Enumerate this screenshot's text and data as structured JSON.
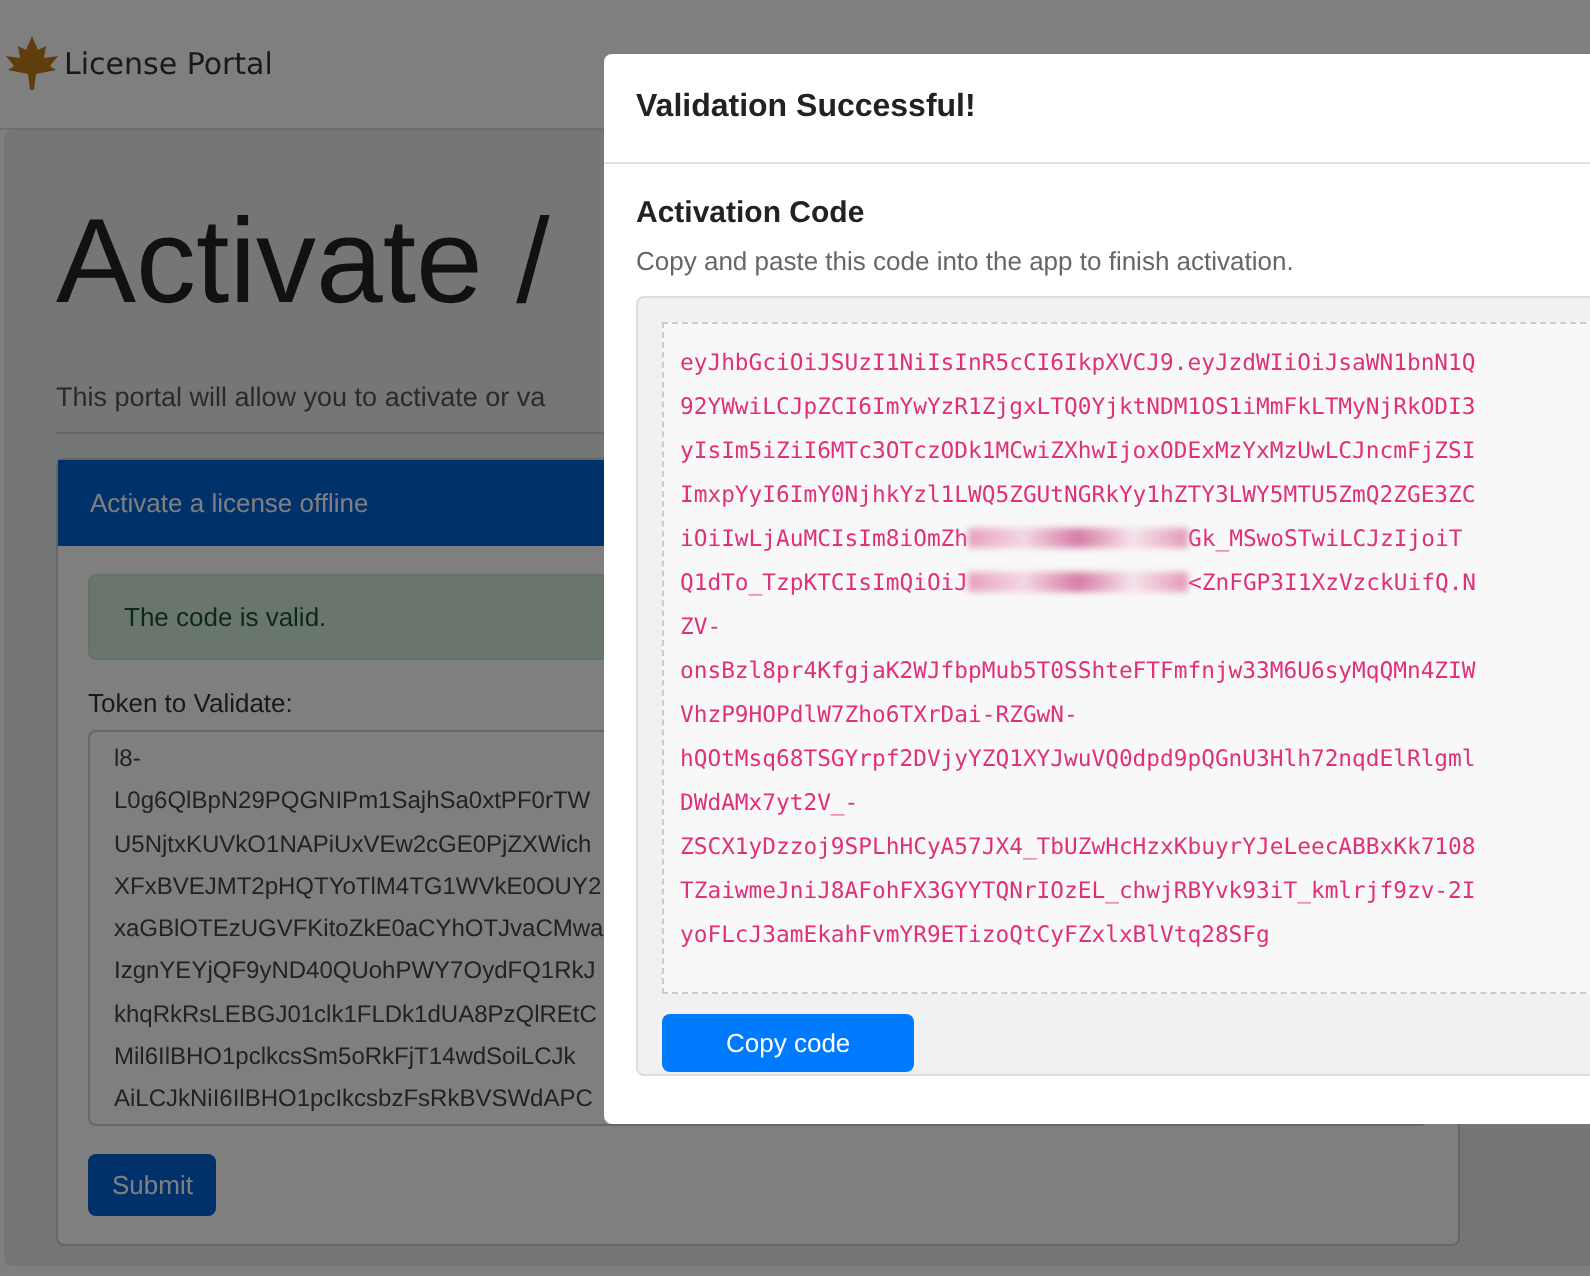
{
  "navbar": {
    "brand": "License Portal"
  },
  "page": {
    "title": "Activate /",
    "subtitle": "This portal will allow you to activate or va",
    "card": {
      "header": "Activate a license offline",
      "alert": "The code is valid.",
      "label": "Token to Validate:",
      "token_lines": [
        "l8-",
        "L0g6QlBpN29PQGNIPm1SajhSa0xtPF0rTW",
        "U5NjtxKUVkO1NAPiUxVEw2cGE0PjZXWich",
        "XFxBVEJMT2pHQTYoTlM4TG1WVkE0OUY2",
        "xaGBlOTEzUGVFKitoZkE0aCYhOTJvaCMwa",
        "IzgnYEYjQF9yND40QUohPWY7OydFQ1RkJ",
        "khqRkRsLEBGJ01clk1FLDk1dUA8PzQlREtC",
        "Mil6IlBHO1pclkcsSm5oRkFjT14wdSoiLCJk",
        "AiLCJkNiI6IlBHO1pcIkcsbzFsRkBVSWdAPC"
      ],
      "submit": "Submit"
    }
  },
  "modal": {
    "title": "Validation Successful!",
    "heading": "Activation Code",
    "hint": "Copy and paste this code into the app to finish activation.",
    "code_lines": [
      {
        "kind": "plain",
        "text": "eyJhbGciOiJSUzI1NiIsInR5cCI6IkpXVCJ9.eyJzdWIiOiJsaWN1bnN1Q"
      },
      {
        "kind": "plain",
        "text": "92YWwiLCJpZCI6ImYwYzR1ZjgxLTQ0YjktNDM1OS1iMmFkLTMyNjRkODI3"
      },
      {
        "kind": "plain",
        "text": "yIsIm5iZiI6MTc3OTczODk1MCwiZXhwIjoxODExMzYxMzUwLCJncmFjZSI"
      },
      {
        "kind": "plain",
        "text": "ImxpYyI6ImY0NjhkYzl1LWQ5ZGUtNGRkYy1hZTY3LWY5MTU5ZmQ2ZGE3ZC"
      },
      {
        "kind": "redacted",
        "before": "iOiIwLjAuMCIsIm8iOmZh",
        "after": "Gk_MSwoSTwiLCJzIjoiT"
      },
      {
        "kind": "redacted",
        "before": "Q1dTo_TzpKTCIsImQiOiJ",
        "after": "<ZnFGP3I1XzVzckUifQ.N"
      },
      {
        "kind": "plain",
        "text": "ZV-"
      },
      {
        "kind": "plain",
        "text": "onsBzl8pr4KfgjaK2WJfbpMub5T0SShteFTFmfnjw33M6U6syMqQMn4ZIW"
      },
      {
        "kind": "plain",
        "text": "VhzP9HOPdlW7Zho6TXrDai-RZGwN-"
      },
      {
        "kind": "plain",
        "text": "hQOtMsq68TSGYrpf2DVjyYZQ1XYJwuVQ0dpd9pQGnU3Hlh72nqdElRlgml"
      },
      {
        "kind": "plain",
        "text": "DWdAMx7yt2V_-"
      },
      {
        "kind": "plain",
        "text": "ZSCX1yDzzoj9SPLhHCyA57JX4_TbUZwHcHzxKbuyrYJeLeecABBxKk7108"
      },
      {
        "kind": "plain",
        "text": "TZaiwmeJniJ8AFohFX3GYYTQNrIOzEL_chwjRBYvk93iT_kmlrjf9zv-2I"
      },
      {
        "kind": "plain",
        "text": "yoFLcJ3amEkahFvmYR9ETizoQtCyFZxlxBlVtq28SFg"
      }
    ],
    "copy_button": "Copy code"
  }
}
